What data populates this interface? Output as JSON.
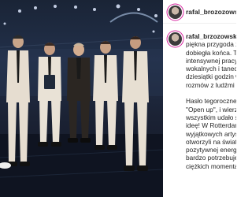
{
  "post": {
    "username": "rafal_brozozowski_official",
    "caption_user": "rafal_brzozowski_official",
    "caption_lines_1": [
      "piękna przygoda z Euro",
      "dobiegła końca. To były",
      "intensywnej pracy. Nie t",
      "wokalnych i tanecznych",
      "dziesiątki godzin wywia",
      "rozmów z ludźmi z całeg"
    ],
    "caption_lines_2": [
      "Hasło tegorocznego ko",
      "\"Open up\", i wierzę, że",
      "wszystkim udało się zwr",
      "ideę! W Rotterdamie po",
      "wyjątkowych artystów, i",
      "otworzyli na świat, pek",
      "pozytywnej energii, któr",
      "bardzo potrzebujemy w",
      "ciężkich momentach."
    ]
  }
}
